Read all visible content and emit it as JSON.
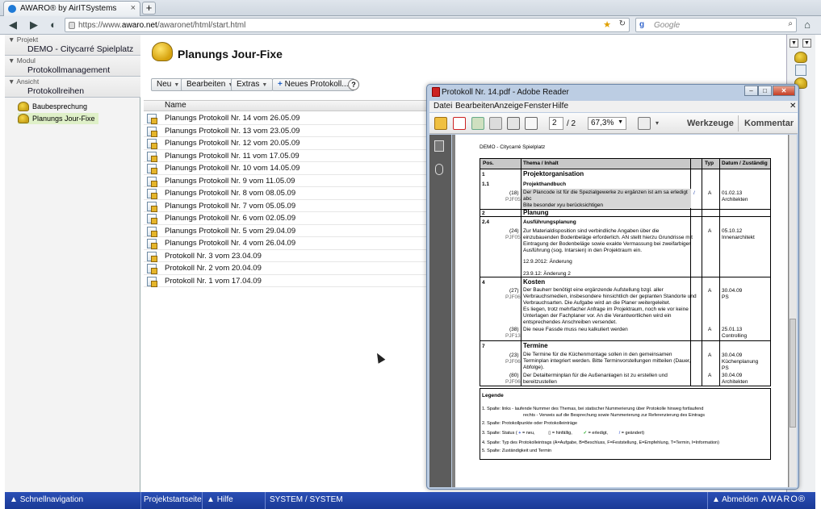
{
  "browser": {
    "tab_title": "AWARO® by AirITSystems",
    "url_prefix": "https://www.",
    "url_domain": "awaro.net",
    "url_path": "/awaronet/html/start.html",
    "search_placeholder": "Google"
  },
  "sidebar": {
    "project_label": "Projekt",
    "project_value": "DEMO - Citycarré Spielplatz",
    "module_label": "Modul",
    "module_value": "Protokollmanagement",
    "view_label": "Ansicht",
    "view_value": "Protokollreihen",
    "items": [
      {
        "label": "Baubesprechung"
      },
      {
        "label": "Planungs Jour-Fixe"
      }
    ]
  },
  "main": {
    "title": "Planungs Jour-Fixe",
    "toolbar": {
      "neu": "Neu",
      "bearbeiten": "Bearbeiten",
      "extras": "Extras",
      "neues_protokoll": "Neues Protokoll...",
      "help": "?"
    },
    "column_header": "Name",
    "rows": [
      "Planungs Protokoll Nr. 14 vom 26.05.09",
      "Planungs Protokoll Nr. 13 vom 23.05.09",
      "Planungs Protokoll Nr. 12 vom 20.05.09",
      "Planungs Protokoll Nr. 11 vom 17.05.09",
      "Planungs Protokoll Nr. 10 vom 14.05.09",
      "Planungs Protokoll Nr. 9 vom 11.05.09",
      "Planungs Protokoll Nr. 8 vom 08.05.09",
      "Planungs Protokoll Nr. 7 vom 05.05.09",
      "Planungs Protokoll Nr. 6 vom 02.05.09",
      "Planungs Protokoll Nr. 5 vom 29.04.09",
      "Planungs Protokoll Nr. 4 vom 26.04.09",
      "Protokoll Nr. 3 vom 23.04.09",
      "Protokoll Nr. 2 vom 20.04.09",
      "Protokoll Nr. 1 vom 17.04.09"
    ]
  },
  "footer": {
    "schnellnavigation": "Schnellnavigation",
    "projektstartseite": "Projektstartseite",
    "hilfe": "Hilfe",
    "user": "SYSTEM / SYSTEM",
    "abmelden": "Abmelden",
    "brand": "AWARO®"
  },
  "reader": {
    "title": "Protokoll Nr. 14.pdf - Adobe Reader",
    "menu": [
      "Datei",
      "Bearbeiten",
      "Anzeige",
      "Fenster",
      "Hilfe"
    ],
    "page_current": "2",
    "page_total": "/ 2",
    "zoom": "67,3%",
    "werkzeuge": "Werkzeuge",
    "kommentar": "Kommentar",
    "pdf": {
      "project": "DEMO - Citycarré Spielplatz",
      "headers": [
        "Pos.",
        "Thema / Inhalt",
        "Typ",
        "Datum / Zuständig"
      ],
      "s1_num": "1",
      "s1_title": "Projektorganisation",
      "r11_num": "1.1",
      "r11_title": "Projekthandbuch",
      "r11_ref": "(18)",
      "r11_ref2": "PJF05",
      "r11_text1": "Der Plancode ist für die Spezialgewerke zu ergänzen ist am sa erledigt",
      "r11_text2": "abc",
      "r11_text3": "Bite besonder xyu berücksichtigen",
      "r11_typ": "A",
      "r11_date": "01.02.13",
      "r11_who": "Architekten",
      "s2_num": "2",
      "s2_title": "Planung",
      "r24_num": "2.4",
      "r24_title": "Ausführungsplanung",
      "r24_ref": "(24)",
      "r24_ref2": "PJF05",
      "r24_text1": "Zur Materialdisposition sind verbindliche Angaben über die",
      "r24_text2": "einzubauenden Bodenbeläge erforderlich. AN stellt hierzu Grundrisse mit",
      "r24_text3": "Eintragung der Bodenbeläge sowie exakte Vermassung bei zweifarbiger",
      "r24_text4": "Ausführung (sog. Intarsien) in den Projektraum ein.",
      "r24_text5": "12.9.2012: Änderung",
      "r24_text6": "23.9.12: Änderung 2",
      "r24_typ": "A",
      "r24_date": "05.10.12",
      "r24_who": "Innenarchitekt",
      "s4_num": "4",
      "s4_title": "Kosten",
      "r27_ref": "(27)",
      "r27_ref2": "PJF06",
      "r27_text1": "Der Bauherr benötigt eine ergänzende Aufstellung bzgl. aller",
      "r27_text2": "Verbrauchsmedien, insbesondere hinsichtlich der geplanten Standorte und",
      "r27_text3": "Verbrauchsarten. Die Aufgabe wird an die Planer weitergeleitet.",
      "r27_text4": "Es liegen, trotz mehrfacher Anfrage im Projektraum, noch wie vor keine",
      "r27_text5": "Unterlagen der Fachplaner vor. An die Verantwortlichen wird ein",
      "r27_text6": "entsprechendes Anschreiben versendet.",
      "r27_typ": "A",
      "r27_date": "30.04.09",
      "r27_who": "PS",
      "r38_ref": "(38)",
      "r38_ref2": "PJF13",
      "r38_text": "Die neue Fassde muss neu kalkuliert werden",
      "r38_typ": "A",
      "r38_date": "25.01.13",
      "r38_who": "Controlling",
      "s7_num": "7",
      "s7_title": "Termine",
      "r23_ref": "(23)",
      "r23_ref2": "PJF06",
      "r23_text1": "Die Termine für die Küchenmontage sollen in den gemeinsamen",
      "r23_text2": "Terminplan integriert werden. Bitte Terminvorstellungen mitteilen (Dauer,",
      "r23_text3": "Abfolge).",
      "r23_typ": "A",
      "r23_date": "30.04.09",
      "r23_who": "Küchenplanung",
      "r23_who2": "PS",
      "r80_ref": "(80)",
      "r80_ref2": "PJF06",
      "r80_text1": "Der Detailterminplan für die Außenanlagen ist zu erstellen und",
      "r80_text2": "bereitzustellen",
      "r80_typ": "A",
      "r80_date": "30.04.09",
      "r80_who": "Architekten",
      "legend_title": "Legende",
      "legend1": "1. Spalte: links - laufende Nummer des Themas, bei statischer Nummerierung über Protokolle hinweg fortlaufend",
      "legend1b": "rechts - Verweis auf die Besprechung sowie Nummerierung zur Referenzierung des Eintrags",
      "legend2": "2. Spalte: Protokollpunkte oder Protokolleinträge",
      "legend3a": "3. Spalte: Status (",
      "legend3b": "= neu,",
      "legend3c": "= hinfällig,",
      "legend3d": "= erledigt,",
      "legend3e": "= geändert)",
      "legend4": "4. Spalte: Typ des Protokolleintrags (A=Aufgabe, B=Beschluss, F=Feststellung, E=Empfehlung, T=Termin, I=Information)",
      "legend5": "5. Spalte: Zuständigkeit und Termin"
    }
  },
  "colors": {
    "footer_bg": "#1f44a6",
    "selected_row": "#dff0c8",
    "pdf_icon": "#cc2222"
  }
}
